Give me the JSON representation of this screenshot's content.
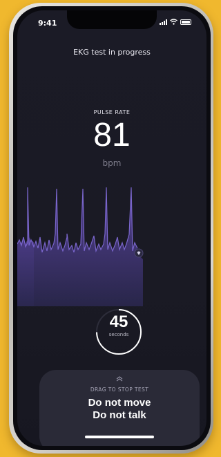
{
  "status_bar": {
    "time": "9:41"
  },
  "header": {
    "title": "EKG test in progress"
  },
  "pulse": {
    "label": "PULSE RATE",
    "value": "81",
    "unit": "bpm"
  },
  "timer": {
    "value": "45",
    "unit": "seconds"
  },
  "drag_panel": {
    "label": "DRAG TO STOP TEST",
    "line1": "Do not move",
    "line2": "Do not talk"
  },
  "colors": {
    "background": "#f0b82e",
    "screen": "#1b1b26",
    "ekg_accent": "#6a52b8"
  },
  "icons": [
    "wifi-icon",
    "battery-icon",
    "signal-icon",
    "heart-icon",
    "chevron-up-icon"
  ]
}
